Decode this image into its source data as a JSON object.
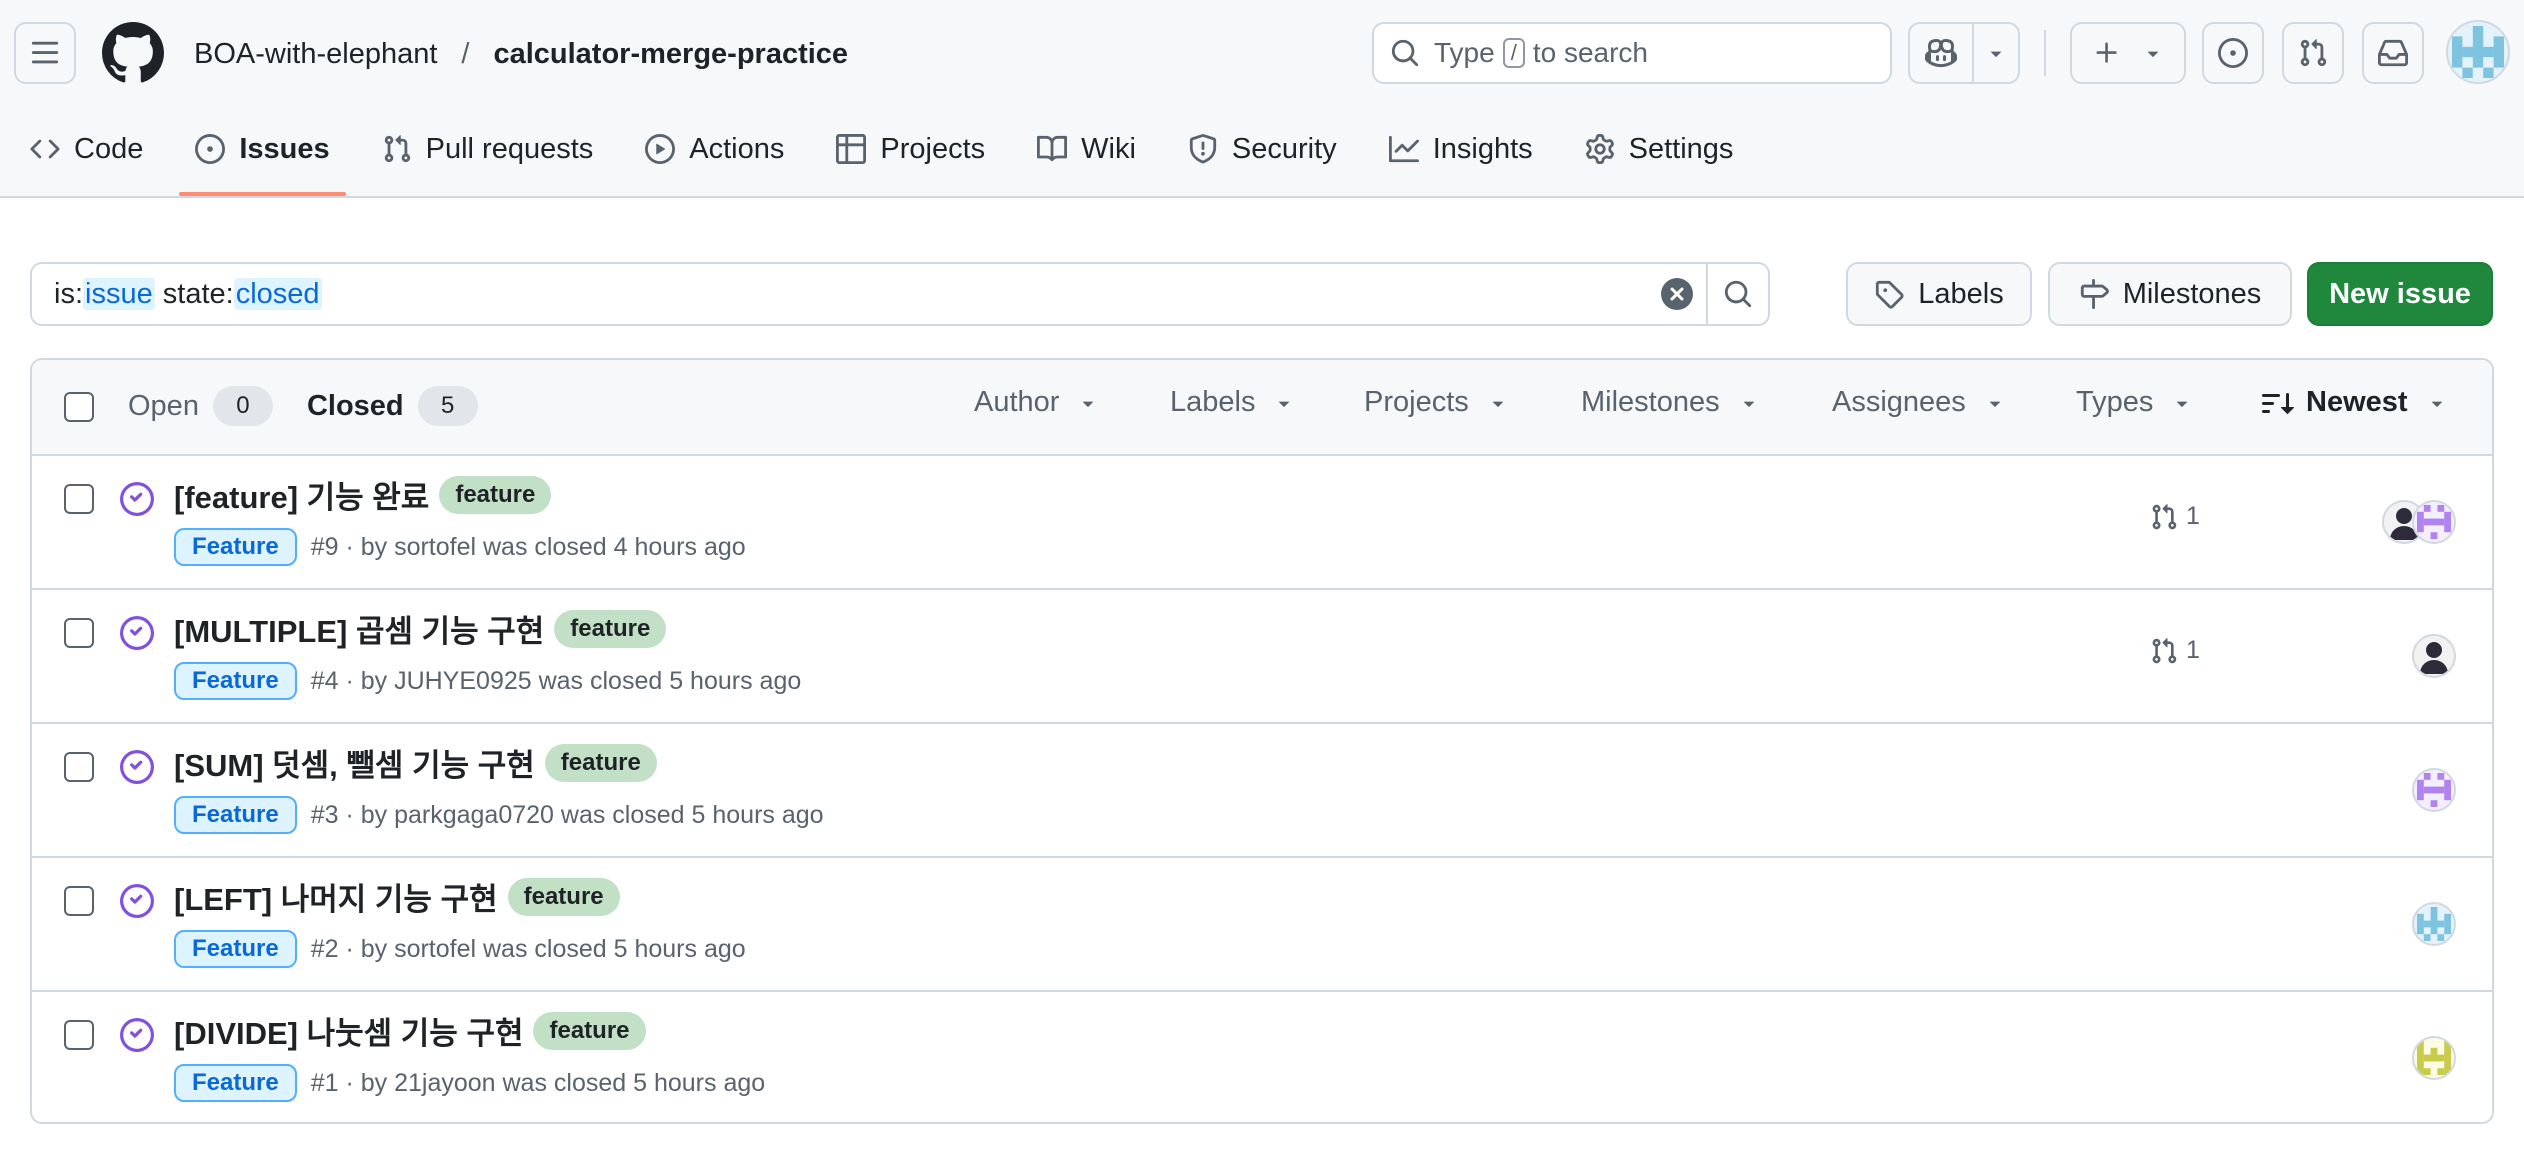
{
  "header": {
    "owner": "BOA-with-elephant",
    "separator": "/",
    "repo": "calculator-merge-practice",
    "search": {
      "prefix": "Type",
      "key": "/",
      "suffix": "to search"
    }
  },
  "nav": {
    "code": "Code",
    "issues": "Issues",
    "pull_requests": "Pull requests",
    "actions": "Actions",
    "projects": "Projects",
    "wiki": "Wiki",
    "security": "Security",
    "insights": "Insights",
    "settings": "Settings"
  },
  "filter_bar": {
    "query_parts": [
      "is:",
      "issue",
      " state:",
      "closed"
    ],
    "labels_button": "Labels",
    "milestones_button": "Milestones",
    "new_issue_button": "New issue"
  },
  "list_header": {
    "open_label": "Open",
    "open_count": "0",
    "closed_label": "Closed",
    "closed_count": "5",
    "filters": {
      "author": "Author",
      "labels": "Labels",
      "projects": "Projects",
      "milestones": "Milestones",
      "assignees": "Assignees",
      "types": "Types",
      "sort": "Newest"
    }
  },
  "issues": [
    {
      "title": "[feature] 기능 완료",
      "label": "feature",
      "type": "Feature",
      "meta": "#9 · by sortofel was closed 4 hours ago",
      "linked_prs": "1"
    },
    {
      "title": "[MULTIPLE] 곱셈 기능 구현",
      "label": "feature",
      "type": "Feature",
      "meta": "#4 · by JUHYE0925 was closed 5 hours ago",
      "linked_prs": "1"
    },
    {
      "title": "[SUM] 덧셈, 뺄셈 기능 구현",
      "label": "feature",
      "type": "Feature",
      "meta": "#3 · by parkgaga0720 was closed 5 hours ago"
    },
    {
      "title": "[LEFT] 나머지 기능 구현",
      "label": "feature",
      "type": "Feature",
      "meta": "#2 · by sortofel was closed 5 hours ago"
    },
    {
      "title": "[DIVIDE] 나눗셈 기능 구현",
      "label": "feature",
      "type": "Feature",
      "meta": "#1 · by 21jayoon was closed 5 hours ago"
    }
  ],
  "colors": {
    "accent_blue": "#0969da",
    "closed_purple": "#8250df",
    "primary_green": "#1f883d",
    "label_feature_bg": "#c2e0c6",
    "active_tab_underline": "#fd8c73"
  },
  "icons": {
    "menu": "hamburger-icon",
    "logo": "github-mark-icon",
    "closed_state": "issue-closed-icon",
    "linked_pr": "git-pull-request-icon"
  }
}
